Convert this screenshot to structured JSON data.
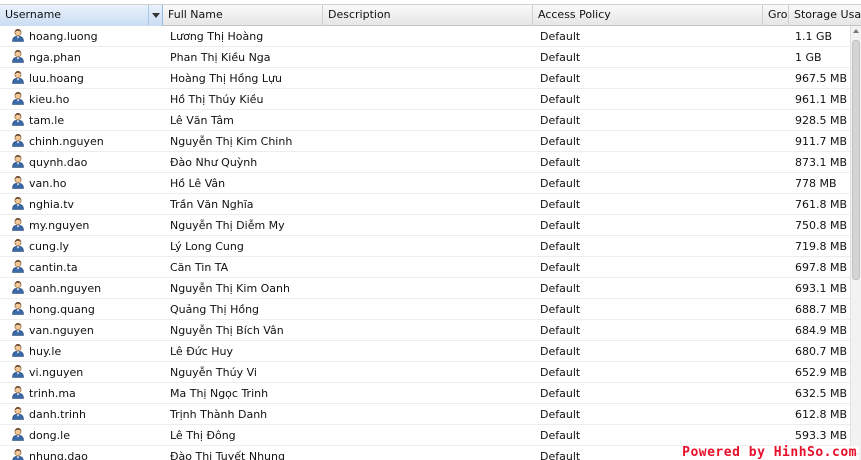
{
  "columns": {
    "username": "Username",
    "full_name": "Full Name",
    "description": "Description",
    "access_policy": "Access Policy",
    "groups": "Gro",
    "storage": "Storage Usag"
  },
  "sorted_column": "username",
  "row_icon": "user-icon",
  "rows": [
    {
      "username": "hoang.luong",
      "full_name": "Lương Thị Hoàng",
      "description": "",
      "access_policy": "Default",
      "storage": "1.1 GB"
    },
    {
      "username": "nga.phan",
      "full_name": "Phan Thị Kiều Nga",
      "description": "",
      "access_policy": "Default",
      "storage": "1 GB"
    },
    {
      "username": "luu.hoang",
      "full_name": "Hoàng Thị Hồng Lựu",
      "description": "",
      "access_policy": "Default",
      "storage": "967.5 MB"
    },
    {
      "username": "kieu.ho",
      "full_name": "Hồ Thị Thúy Kiều",
      "description": "",
      "access_policy": "Default",
      "storage": "961.1 MB"
    },
    {
      "username": "tam.le",
      "full_name": "Lê Văn Tâm",
      "description": "",
      "access_policy": "Default",
      "storage": "928.5 MB"
    },
    {
      "username": "chinh.nguyen",
      "full_name": "Nguyễn Thị Kim Chinh",
      "description": "",
      "access_policy": "Default",
      "storage": "911.7 MB"
    },
    {
      "username": "quynh.dao",
      "full_name": "Đào Như Quỳnh",
      "description": "",
      "access_policy": "Default",
      "storage": "873.1 MB"
    },
    {
      "username": "van.ho",
      "full_name": "Hồ Lê Vân",
      "description": "",
      "access_policy": "Default",
      "storage": "778 MB"
    },
    {
      "username": "nghia.tv",
      "full_name": "Trần Văn Nghĩa",
      "description": "",
      "access_policy": "Default",
      "storage": "761.8 MB"
    },
    {
      "username": "my.nguyen",
      "full_name": "Nguyễn Thị Diễm My",
      "description": "",
      "access_policy": "Default",
      "storage": "750.8 MB"
    },
    {
      "username": "cung.ly",
      "full_name": "Lý Long Cung",
      "description": "",
      "access_policy": "Default",
      "storage": "719.8 MB"
    },
    {
      "username": "cantin.ta",
      "full_name": "Căn Tin TA",
      "description": "",
      "access_policy": "Default",
      "storage": "697.8 MB"
    },
    {
      "username": "oanh.nguyen",
      "full_name": "Nguyễn Thị Kim Oanh",
      "description": "",
      "access_policy": "Default",
      "storage": "693.1 MB"
    },
    {
      "username": "hong.quang",
      "full_name": "Quảng Thị Hồng",
      "description": "",
      "access_policy": "Default",
      "storage": "688.7 MB"
    },
    {
      "username": "van.nguyen",
      "full_name": "Nguyễn Thị Bích Vân",
      "description": "",
      "access_policy": "Default",
      "storage": "684.9 MB"
    },
    {
      "username": "huy.le",
      "full_name": "Lê Đức Huy",
      "description": "",
      "access_policy": "Default",
      "storage": "680.7 MB"
    },
    {
      "username": "vi.nguyen",
      "full_name": "Nguyễn Thúy Vi",
      "description": "",
      "access_policy": "Default",
      "storage": "652.9 MB"
    },
    {
      "username": "trinh.ma",
      "full_name": "Ma Thị Ngọc Trinh",
      "description": "",
      "access_policy": "Default",
      "storage": "632.5 MB"
    },
    {
      "username": "danh.trinh",
      "full_name": "Trịnh Thành Danh",
      "description": "",
      "access_policy": "Default",
      "storage": "612.8 MB"
    },
    {
      "username": "dong.le",
      "full_name": "Lê Thị Đông",
      "description": "",
      "access_policy": "Default",
      "storage": "593.3 MB"
    },
    {
      "username": "nhung.dao",
      "full_name": "Đào Thị Tuyết Nhung",
      "description": "",
      "access_policy": "Default",
      "storage": ""
    }
  ],
  "watermark": "Powered by HinhSo.com"
}
